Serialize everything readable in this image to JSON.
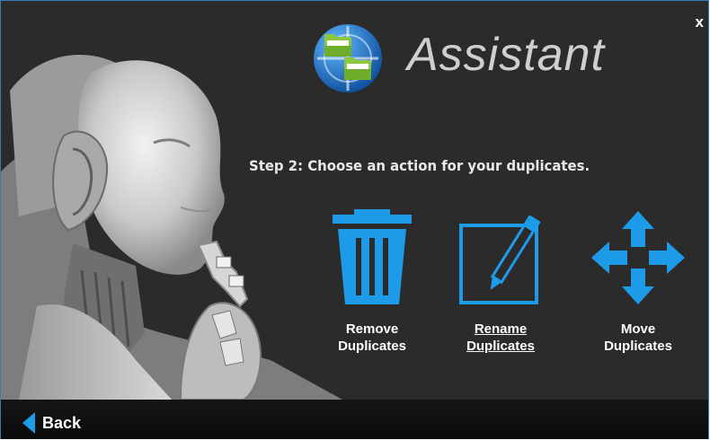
{
  "app": {
    "title": "Assistant",
    "close_label": "x"
  },
  "step": {
    "text": "Step 2:  Choose an action for your duplicates."
  },
  "actions": [
    {
      "line1": "Remove",
      "line2": "Duplicates",
      "icon": "trash-icon"
    },
    {
      "line1": "Rename",
      "line2": "Duplicates",
      "icon": "edit-pencil-icon"
    },
    {
      "line1": "Move",
      "line2": "Duplicates",
      "icon": "move-arrows-icon"
    }
  ],
  "footer": {
    "back_label": "Back"
  },
  "colors": {
    "accent": "#1e9be8",
    "background": "#2b2b2b",
    "footer": "#111111"
  }
}
